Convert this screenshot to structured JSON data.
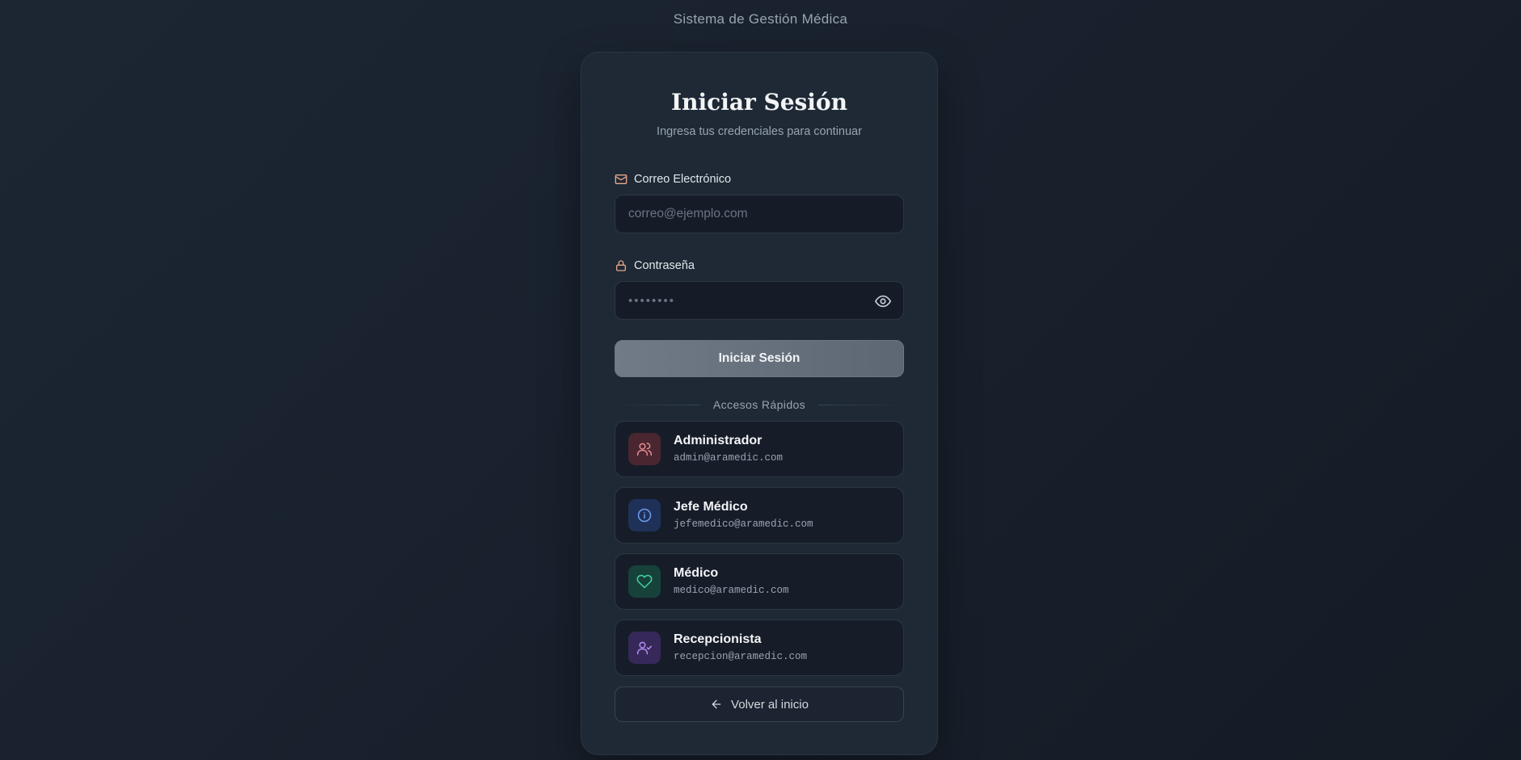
{
  "header": {
    "app_title": "Sistema de Gestión Médica"
  },
  "login": {
    "title": "Iniciar Sesión",
    "subtitle": "Ingresa tus credenciales para continuar",
    "email": {
      "label": "Correo Electrónico",
      "placeholder": "correo@ejemplo.com",
      "value": "",
      "icon": "mail-icon",
      "icon_color": "#e7a58c"
    },
    "password": {
      "label": "Contraseña",
      "placeholder": "••••••••",
      "value": "",
      "icon": "lock-icon",
      "icon_color": "#e7a58c",
      "toggle_icon": "eye-icon"
    },
    "submit_label": "Iniciar Sesión"
  },
  "quick_access": {
    "title": "Accesos Rápidos",
    "items": [
      {
        "role": "Administrador",
        "email": "admin@aramedic.com",
        "icon": "users-icon",
        "icon_color": "#e58a8f",
        "badge_color": "#4a2630"
      },
      {
        "role": "Jefe Médico",
        "email": "jefemedico@aramedic.com",
        "icon": "info-circle-icon",
        "icon_color": "#6f9bf0",
        "badge_color": "#1f3159"
      },
      {
        "role": "Médico",
        "email": "medico@aramedic.com",
        "icon": "heart-icon",
        "icon_color": "#41d39f",
        "badge_color": "#17423b"
      },
      {
        "role": "Recepcionista",
        "email": "recepcion@aramedic.com",
        "icon": "user-check-icon",
        "icon_color": "#b08ef0",
        "badge_color": "#37285a"
      }
    ]
  },
  "footer": {
    "back_label": "Volver al inicio",
    "back_icon": "arrow-left-icon"
  }
}
